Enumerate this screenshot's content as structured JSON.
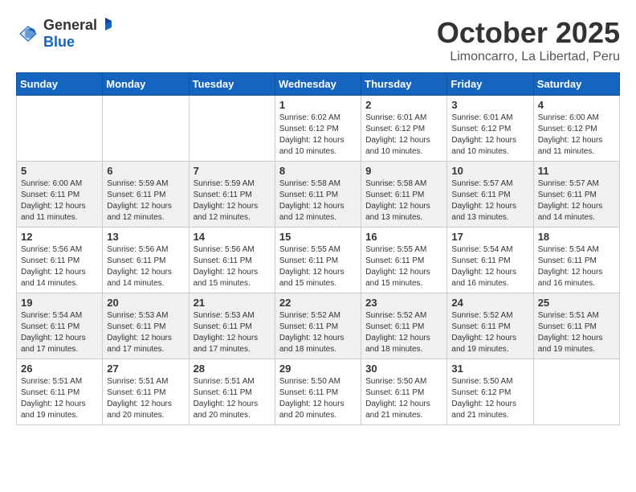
{
  "header": {
    "logo_general": "General",
    "logo_blue": "Blue",
    "month": "October 2025",
    "location": "Limoncarro, La Libertad, Peru"
  },
  "weekdays": [
    "Sunday",
    "Monday",
    "Tuesday",
    "Wednesday",
    "Thursday",
    "Friday",
    "Saturday"
  ],
  "weeks": [
    [
      {
        "day": "",
        "info": ""
      },
      {
        "day": "",
        "info": ""
      },
      {
        "day": "",
        "info": ""
      },
      {
        "day": "1",
        "info": "Sunrise: 6:02 AM\nSunset: 6:12 PM\nDaylight: 12 hours and 10 minutes."
      },
      {
        "day": "2",
        "info": "Sunrise: 6:01 AM\nSunset: 6:12 PM\nDaylight: 12 hours and 10 minutes."
      },
      {
        "day": "3",
        "info": "Sunrise: 6:01 AM\nSunset: 6:12 PM\nDaylight: 12 hours and 10 minutes."
      },
      {
        "day": "4",
        "info": "Sunrise: 6:00 AM\nSunset: 6:12 PM\nDaylight: 12 hours and 11 minutes."
      }
    ],
    [
      {
        "day": "5",
        "info": "Sunrise: 6:00 AM\nSunset: 6:11 PM\nDaylight: 12 hours and 11 minutes."
      },
      {
        "day": "6",
        "info": "Sunrise: 5:59 AM\nSunset: 6:11 PM\nDaylight: 12 hours and 12 minutes."
      },
      {
        "day": "7",
        "info": "Sunrise: 5:59 AM\nSunset: 6:11 PM\nDaylight: 12 hours and 12 minutes."
      },
      {
        "day": "8",
        "info": "Sunrise: 5:58 AM\nSunset: 6:11 PM\nDaylight: 12 hours and 12 minutes."
      },
      {
        "day": "9",
        "info": "Sunrise: 5:58 AM\nSunset: 6:11 PM\nDaylight: 12 hours and 13 minutes."
      },
      {
        "day": "10",
        "info": "Sunrise: 5:57 AM\nSunset: 6:11 PM\nDaylight: 12 hours and 13 minutes."
      },
      {
        "day": "11",
        "info": "Sunrise: 5:57 AM\nSunset: 6:11 PM\nDaylight: 12 hours and 14 minutes."
      }
    ],
    [
      {
        "day": "12",
        "info": "Sunrise: 5:56 AM\nSunset: 6:11 PM\nDaylight: 12 hours and 14 minutes."
      },
      {
        "day": "13",
        "info": "Sunrise: 5:56 AM\nSunset: 6:11 PM\nDaylight: 12 hours and 14 minutes."
      },
      {
        "day": "14",
        "info": "Sunrise: 5:56 AM\nSunset: 6:11 PM\nDaylight: 12 hours and 15 minutes."
      },
      {
        "day": "15",
        "info": "Sunrise: 5:55 AM\nSunset: 6:11 PM\nDaylight: 12 hours and 15 minutes."
      },
      {
        "day": "16",
        "info": "Sunrise: 5:55 AM\nSunset: 6:11 PM\nDaylight: 12 hours and 15 minutes."
      },
      {
        "day": "17",
        "info": "Sunrise: 5:54 AM\nSunset: 6:11 PM\nDaylight: 12 hours and 16 minutes."
      },
      {
        "day": "18",
        "info": "Sunrise: 5:54 AM\nSunset: 6:11 PM\nDaylight: 12 hours and 16 minutes."
      }
    ],
    [
      {
        "day": "19",
        "info": "Sunrise: 5:54 AM\nSunset: 6:11 PM\nDaylight: 12 hours and 17 minutes."
      },
      {
        "day": "20",
        "info": "Sunrise: 5:53 AM\nSunset: 6:11 PM\nDaylight: 12 hours and 17 minutes."
      },
      {
        "day": "21",
        "info": "Sunrise: 5:53 AM\nSunset: 6:11 PM\nDaylight: 12 hours and 17 minutes."
      },
      {
        "day": "22",
        "info": "Sunrise: 5:52 AM\nSunset: 6:11 PM\nDaylight: 12 hours and 18 minutes."
      },
      {
        "day": "23",
        "info": "Sunrise: 5:52 AM\nSunset: 6:11 PM\nDaylight: 12 hours and 18 minutes."
      },
      {
        "day": "24",
        "info": "Sunrise: 5:52 AM\nSunset: 6:11 PM\nDaylight: 12 hours and 19 minutes."
      },
      {
        "day": "25",
        "info": "Sunrise: 5:51 AM\nSunset: 6:11 PM\nDaylight: 12 hours and 19 minutes."
      }
    ],
    [
      {
        "day": "26",
        "info": "Sunrise: 5:51 AM\nSunset: 6:11 PM\nDaylight: 12 hours and 19 minutes."
      },
      {
        "day": "27",
        "info": "Sunrise: 5:51 AM\nSunset: 6:11 PM\nDaylight: 12 hours and 20 minutes."
      },
      {
        "day": "28",
        "info": "Sunrise: 5:51 AM\nSunset: 6:11 PM\nDaylight: 12 hours and 20 minutes."
      },
      {
        "day": "29",
        "info": "Sunrise: 5:50 AM\nSunset: 6:11 PM\nDaylight: 12 hours and 20 minutes."
      },
      {
        "day": "30",
        "info": "Sunrise: 5:50 AM\nSunset: 6:11 PM\nDaylight: 12 hours and 21 minutes."
      },
      {
        "day": "31",
        "info": "Sunrise: 5:50 AM\nSunset: 6:12 PM\nDaylight: 12 hours and 21 minutes."
      },
      {
        "day": "",
        "info": ""
      }
    ]
  ]
}
